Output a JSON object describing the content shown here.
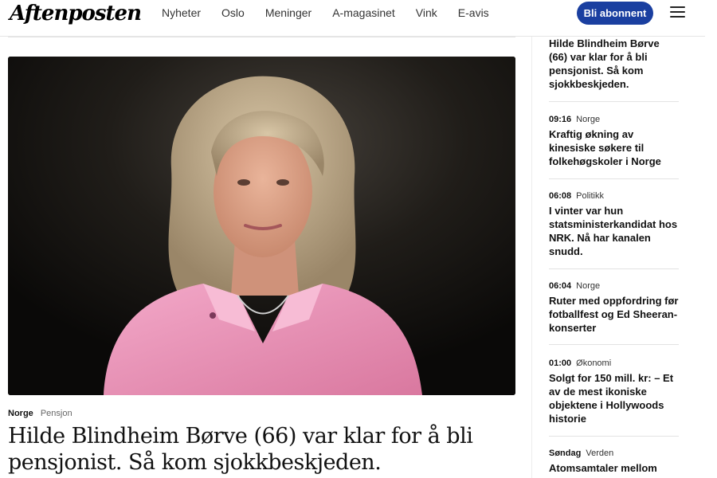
{
  "header": {
    "logo": "Aftenposten",
    "nav": [
      "Nyheter",
      "Oslo",
      "Meninger",
      "A-magasinet",
      "Vink",
      "E-avis"
    ],
    "subscribe_label": "Bli abonnent"
  },
  "article": {
    "section": "Norge",
    "tag": "Pensjon",
    "headline": "Hilde Blindheim Børve (66) var klar for å bli pensjonist. Så kom sjokkbeskjeden."
  },
  "sidebar": {
    "items": [
      {
        "time": "",
        "category": "",
        "title": "Hilde Blindheim Børve (66) var klar for å bli pensjonist. Så kom sjokkbeskjeden."
      },
      {
        "time": "09:16",
        "category": "Norge",
        "title": "Kraftig økning av kinesiske søkere til folkehøgskoler i Norge"
      },
      {
        "time": "06:08",
        "category": "Politikk",
        "title": "I vinter var hun statsministerkandidat hos NRK. Nå har kanalen snudd."
      },
      {
        "time": "06:04",
        "category": "Norge",
        "title": "Ruter med oppfordring før fotballfest og Ed Sheeran-konserter"
      },
      {
        "time": "01:00",
        "category": "Økonomi",
        "title": "Solgt for 150 mill. kr: – Et av de mest ikoniske objektene i Hollywoods historie"
      },
      {
        "time": "Søndag",
        "category": "Verden",
        "title": "Atomsamtaler mellom"
      }
    ]
  },
  "colors": {
    "brand_blue": "#1a3fa0"
  }
}
